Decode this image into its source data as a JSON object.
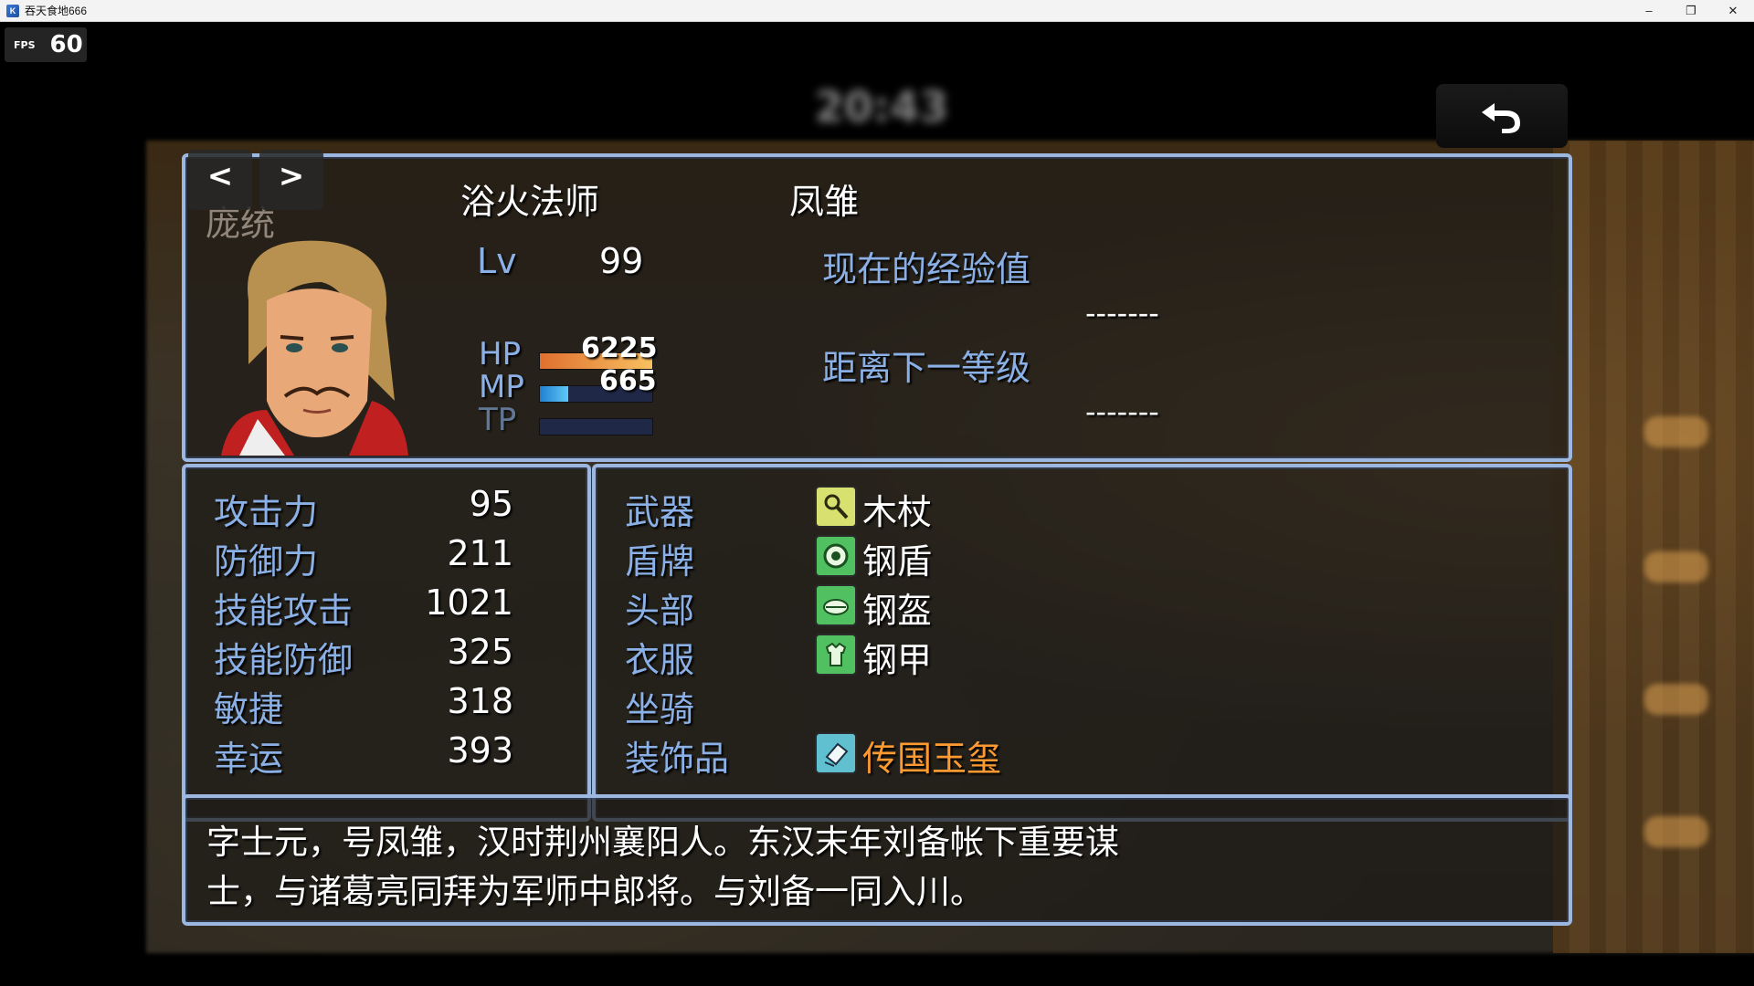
{
  "window": {
    "title": "吞天食地666",
    "minimize": "–",
    "restore": "❐",
    "close": "✕"
  },
  "fps": {
    "label": "FPS",
    "value": "60"
  },
  "clock": "20:43",
  "back_button": {
    "icon": "back-arrow-icon"
  },
  "actor": {
    "nav_prev": "<",
    "nav_next": ">",
    "name_behind": "庞统",
    "class": "浴火法师",
    "nickname": "凤雏",
    "level_label": "Lv",
    "level": "99",
    "exp_label": "现在的经验值",
    "exp_value": "-------",
    "next_label": "距离下一等级",
    "next_value": "-------",
    "hp_label": "HP",
    "hp": "6225",
    "hp_ratio": 1.0,
    "mp_label": "MP",
    "mp": "665",
    "mp_ratio": 0.25,
    "tp_label": "TP",
    "tp_ratio": 0.0
  },
  "params": [
    {
      "label": "攻击力",
      "value": "95"
    },
    {
      "label": "防御力",
      "value": "211"
    },
    {
      "label": "技能攻击",
      "value": "1021"
    },
    {
      "label": "技能防御",
      "value": "325"
    },
    {
      "label": "敏捷",
      "value": "318"
    },
    {
      "label": "幸运",
      "value": "393"
    }
  ],
  "equipment": [
    {
      "slot": "武器",
      "item": "木杖",
      "icon": "staff-icon"
    },
    {
      "slot": "盾牌",
      "item": "钢盾",
      "icon": "shield-icon"
    },
    {
      "slot": "头部",
      "item": "钢盔",
      "icon": "helmet-icon"
    },
    {
      "slot": "衣服",
      "item": "钢甲",
      "icon": "armor-icon"
    },
    {
      "slot": "坐骑",
      "item": "",
      "icon": ""
    },
    {
      "slot": "装饰品",
      "item": "传国玉玺",
      "icon": "seal-icon"
    }
  ],
  "profile": {
    "line1": "字士元，号凤雏，汉时荆州襄阳人。东汉末年刘备帐下重要谋",
    "line2": "士，与诸葛亮同拜为军师中郎将。与刘备一同入川。"
  },
  "colors": {
    "system_blue": "#8ab0e6",
    "hp_bar": "#f0a040",
    "mp_bar": "#40a8e8",
    "rare_item": "#ff9a30",
    "panel_border": "#9cb8e0"
  }
}
